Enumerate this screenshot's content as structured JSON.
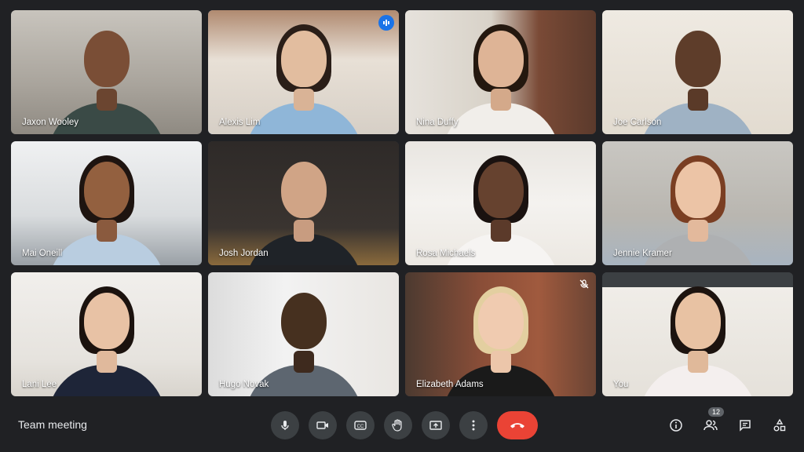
{
  "participants": [
    {
      "name": "Jaxon Wooley"
    },
    {
      "name": "Alexis Lim"
    },
    {
      "name": "Nina Duffy"
    },
    {
      "name": "Joe Carlson"
    },
    {
      "name": "Mai Oneill"
    },
    {
      "name": "Josh Jordan"
    },
    {
      "name": "Rosa Michaels"
    },
    {
      "name": "Jennie Kramer"
    },
    {
      "name": "Lani Lee"
    },
    {
      "name": "Hugo Novak"
    },
    {
      "name": "Elizabeth Adams"
    },
    {
      "name": "You"
    }
  ],
  "meeting": {
    "title": "Team meeting"
  },
  "people_count": "12",
  "colors": {
    "background": "#202124",
    "control": "#3c4043",
    "end_call": "#ea4335",
    "speaking_outline": "#8ab4f8",
    "speaking_badge": "#1a73e8"
  },
  "icons": {
    "controls": [
      "microphone-icon",
      "camera-icon",
      "captions-icon",
      "raise-hand-icon",
      "present-icon",
      "more-options-icon",
      "end-call-icon"
    ],
    "right": [
      "info-icon",
      "people-icon",
      "chat-icon",
      "activities-icon"
    ]
  }
}
